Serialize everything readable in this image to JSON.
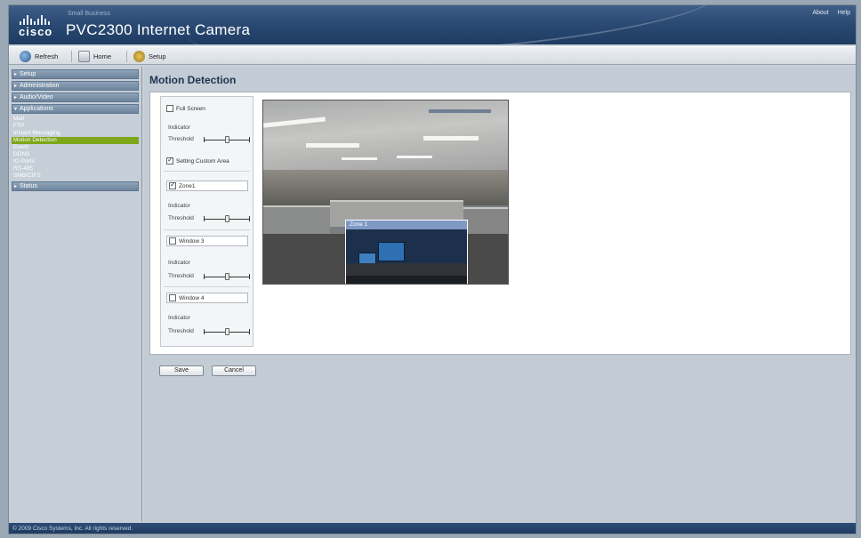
{
  "header": {
    "brand": "cisco",
    "subtitle": "Small Business",
    "app_title": "PVC2300 Internet Camera",
    "links": {
      "about": "About",
      "help": "Help"
    }
  },
  "toolbar": {
    "refresh_label": "Refresh",
    "home_label": "Home",
    "setup_label": "Setup"
  },
  "sidebar": {
    "sections": {
      "setup": "Setup",
      "administration": "Administration",
      "audio_video": "Audio/Video",
      "applications": "Applications",
      "status": "Status"
    },
    "items": [
      "Mail",
      "FTP",
      "Instant Messaging",
      "Motion Detection",
      "Event",
      "DDNS",
      "IO Ports",
      "RS-485",
      "SMB/CIFS"
    ],
    "active_item": "Motion Detection"
  },
  "main": {
    "title": "Motion Detection",
    "panel": {
      "full_screen_label": "Full Screen",
      "full_screen_checked": false,
      "custom_area_label": "Setting Custom Area",
      "custom_area_checked": true,
      "zones": [
        {
          "name": "Zone1",
          "checked": true,
          "indicator_label": "Indicator",
          "threshold_label": "Threshold",
          "threshold": 0.5
        },
        {
          "name": "Window 3",
          "checked": false,
          "indicator_label": "Indicator",
          "threshold_label": "Threshold",
          "threshold": 0.5
        },
        {
          "name": "Window 4",
          "checked": false,
          "indicator_label": "Indicator",
          "threshold_label": "Threshold",
          "threshold": 0.5
        }
      ],
      "global": {
        "indicator_label": "Indicator",
        "threshold_label": "Threshold",
        "threshold": 0.5
      }
    },
    "camera": {
      "zone_overlay_title": "Zone 1"
    },
    "buttons": {
      "save": "Save",
      "cancel": "Cancel"
    }
  },
  "footer": {
    "copyright": "© 2009 Cisco Systems, Inc. All rights reserved."
  },
  "colors": {
    "header_top": "#3f5f87",
    "header_bottom": "#1e3b62",
    "active_nav": "#7ea619",
    "section_bg": "#6d849c",
    "zone_title": "#7f99c5"
  }
}
